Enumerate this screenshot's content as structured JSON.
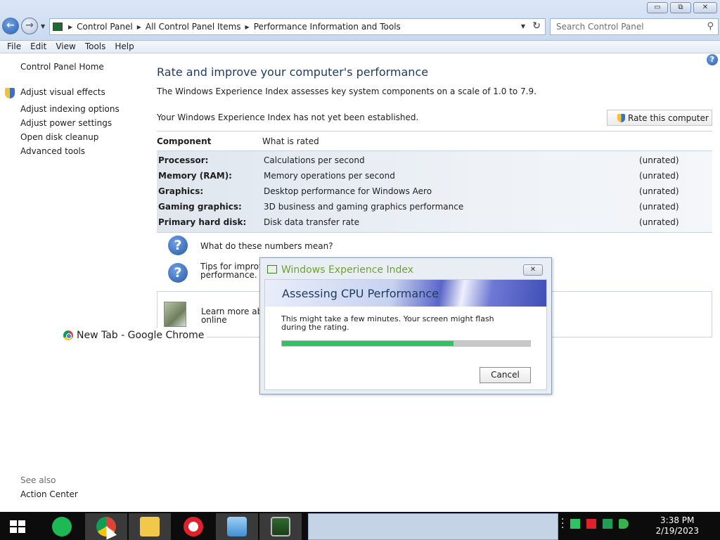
{
  "window": {
    "minimize_glyph": "▭",
    "maximize_glyph": "⧉",
    "close_glyph": "✕"
  },
  "nav": {
    "back_glyph": "←",
    "forward_glyph": "→",
    "breadcrumbs": [
      "Control Panel",
      "All Control Panel Items",
      "Performance Information and Tools"
    ],
    "search_placeholder": "Search Control Panel"
  },
  "menu": [
    "File",
    "Edit",
    "View",
    "Tools",
    "Help"
  ],
  "leftnav": {
    "home": "Control Panel Home",
    "links": [
      "Adjust visual effects",
      "Adjust indexing options",
      "Adjust power settings",
      "Open disk cleanup",
      "Advanced tools"
    ],
    "see_also_heading": "See also",
    "see_also_link": "Action Center"
  },
  "main": {
    "title": "Rate and improve your computer's performance",
    "description": "The Windows Experience Index assesses key system components on a scale of 1.0 to 7.9.",
    "status": "Your Windows Experience Index has not yet been established.",
    "rate_button": "Rate this computer",
    "table": {
      "headers": [
        "Component",
        "What is rated"
      ],
      "rows": [
        {
          "component": "Processor:",
          "rated": "Calculations per second",
          "score": "(unrated)"
        },
        {
          "component": "Memory (RAM):",
          "rated": "Memory operations per second",
          "score": "(unrated)"
        },
        {
          "component": "Graphics:",
          "rated": "Desktop performance for Windows Aero",
          "score": "(unrated)"
        },
        {
          "component": "Gaming graphics:",
          "rated": "3D business and gaming graphics performance",
          "score": "(unrated)"
        },
        {
          "component": "Primary hard disk:",
          "rated": "Disk data transfer rate",
          "score": "(unrated)"
        }
      ]
    },
    "help_links": [
      "What do these numbers mean?",
      "Tips for improvi",
      "performance."
    ],
    "learn_more": [
      "Learn more abo",
      "online"
    ]
  },
  "tooltip": {
    "chrome": "New Tab - Google Chrome"
  },
  "dialog": {
    "title": "Windows Experience Index",
    "heading": "Assessing CPU Performance",
    "message": "This might take a few minutes. Your screen might flash during the rating.",
    "progress_percent": 69,
    "cancel": "Cancel"
  },
  "taskbar": {
    "time": "3:38 PM",
    "date": "2/19/2023"
  },
  "colors": {
    "progress": "#2ec464",
    "dialog_title": "#6ea22c",
    "heading": "#1e3a5f"
  }
}
